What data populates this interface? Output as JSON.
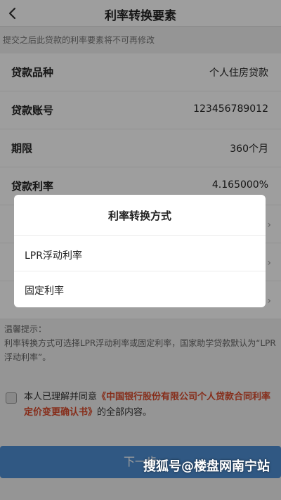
{
  "header": {
    "title": "利率转换要素"
  },
  "notice": "提交之后此贷款的利率要素将不可再修改",
  "rows": [
    {
      "label": "贷款品种",
      "value": "个人住房贷款"
    },
    {
      "label": "贷款账号",
      "value": "123456789012"
    },
    {
      "label": "期限",
      "value": "360个月"
    },
    {
      "label": "贷款利率",
      "value": "4.165000%"
    }
  ],
  "tips": {
    "title": "温馨提示：",
    "body": "利率转换方式可选择LPR浮动利率或固定利率，国家助学贷款默认为“LPR浮动利率”。"
  },
  "agreement": {
    "prefix": "本人已理解并同意",
    "link": "《中国银行股份有限公司个人贷款合同利率定价变更确认书》",
    "suffix": "的全部内容。"
  },
  "next_button": "下一步",
  "dialog": {
    "title": "利率转换方式",
    "options": [
      "LPR浮动利率",
      "固定利率"
    ]
  },
  "watermark": "搜狐号@楼盘网南宁站",
  "colors": {
    "primary_button": "#4e8fd3",
    "link": "#d94a2b"
  }
}
